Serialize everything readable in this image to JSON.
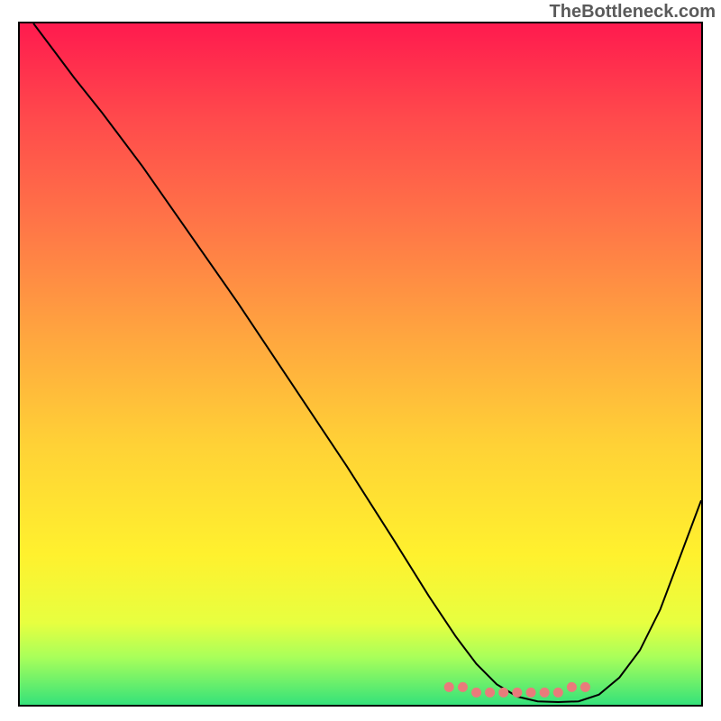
{
  "watermark": "TheBottleneck.com",
  "chart_data": {
    "type": "line",
    "title": "",
    "xlabel": "",
    "ylabel": "",
    "x_range": [
      0,
      100
    ],
    "y_range": [
      0,
      100
    ],
    "grid": false,
    "legend": null,
    "series": [
      {
        "name": "main-curve",
        "x": [
          2,
          5,
          8,
          12,
          18,
          25,
          32,
          40,
          48,
          55,
          60,
          64,
          67,
          70,
          73,
          76,
          79,
          82,
          85,
          88,
          91,
          94,
          97,
          100
        ],
        "y": [
          100,
          96,
          92,
          87,
          79,
          69,
          59,
          47,
          35,
          24,
          16,
          10,
          6,
          3,
          1.2,
          0.5,
          0.4,
          0.5,
          1.5,
          4,
          8,
          14,
          22,
          30
        ]
      }
    ],
    "bottom_dots": {
      "name": "optimal-zone-markers",
      "x": [
        63,
        65,
        67,
        69,
        71,
        73,
        75,
        77,
        79,
        81,
        83
      ],
      "y_percent_from_bottom": 1.8
    },
    "background_gradient": {
      "stops": [
        {
          "pos": 0.0,
          "color": "#ff1a4e"
        },
        {
          "pos": 0.14,
          "color": "#ff4a4c"
        },
        {
          "pos": 0.3,
          "color": "#ff7747"
        },
        {
          "pos": 0.46,
          "color": "#ffa63f"
        },
        {
          "pos": 0.62,
          "color": "#ffd236"
        },
        {
          "pos": 0.78,
          "color": "#fff12e"
        },
        {
          "pos": 0.88,
          "color": "#e7ff40"
        },
        {
          "pos": 0.93,
          "color": "#a9ff5a"
        },
        {
          "pos": 1.0,
          "color": "#35e27a"
        }
      ]
    }
  }
}
